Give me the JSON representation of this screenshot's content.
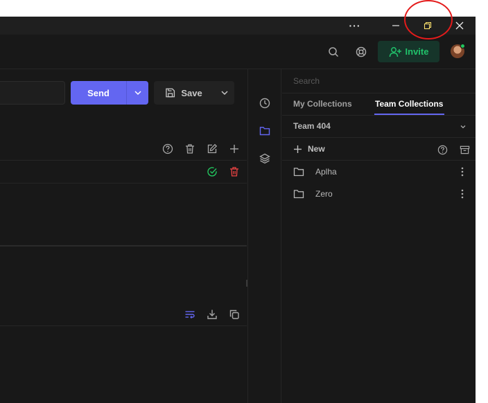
{
  "window": {
    "more_icon": "ellipsis-icon",
    "minimize_icon": "minimize-icon",
    "restore_icon": "restore-icon",
    "close_icon": "close-icon"
  },
  "header": {
    "search_icon": "search-icon",
    "help_icon": "lifebuoy-icon",
    "invite_label": "Invite",
    "status_color": "#22c55e"
  },
  "request": {
    "send_label": "Send",
    "save_label": "Save",
    "accent": "#6366f1"
  },
  "sidebar": {
    "search_placeholder": "Search",
    "tabs": [
      {
        "label": "My Collections"
      },
      {
        "label": "Team Collections"
      }
    ],
    "team": "Team 404",
    "new_label": "New",
    "collections": [
      {
        "label": "Aplha"
      },
      {
        "label": "Zero"
      }
    ]
  }
}
